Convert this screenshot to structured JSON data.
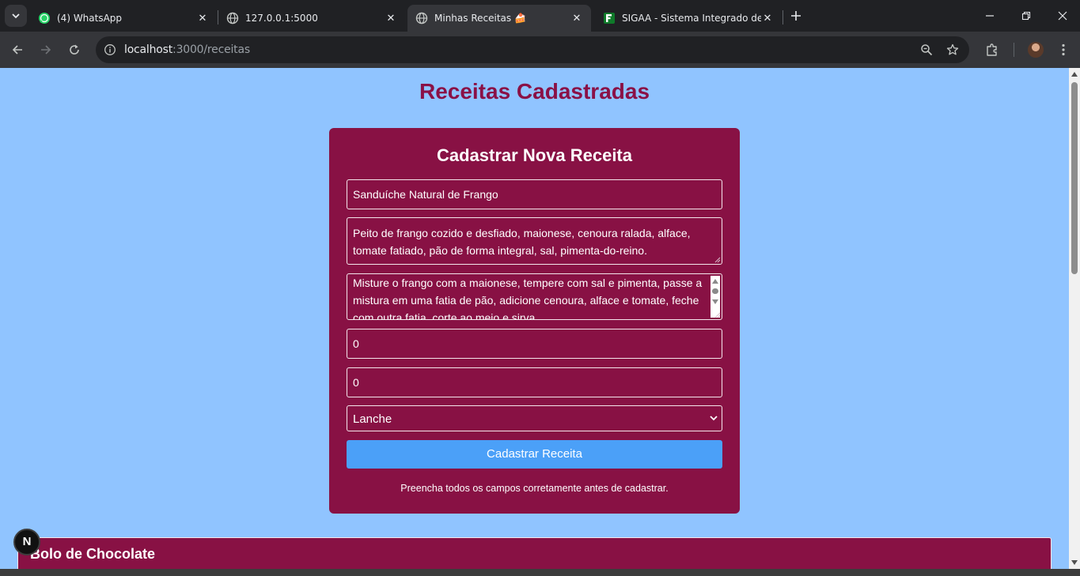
{
  "browser": {
    "tabs": [
      {
        "title": "(4) WhatsApp",
        "icon": "whatsapp-icon"
      },
      {
        "title": "127.0.0.1:5000",
        "icon": "globe-icon"
      },
      {
        "title": "Minhas Receitas 🍰",
        "icon": "globe-icon",
        "active": true
      },
      {
        "title": "SIGAA - Sistema Integrado de G",
        "icon": "sigaa-icon"
      }
    ],
    "url": {
      "host": "localhost",
      "path": ":3000/receitas"
    },
    "colors": {
      "frame": "#202124",
      "toolbar": "#35363a"
    }
  },
  "page": {
    "title": "Receitas Cadastradas",
    "colors": {
      "background": "#90c4ff",
      "card": "#881144",
      "title": "#8a1146",
      "button": "#4ba0f8"
    },
    "form": {
      "heading": "Cadastrar Nova Receita",
      "name_value": "Sanduíche Natural de Frango",
      "ingredients_value": "Peito de frango cozido e desfiado, maionese, cenoura ralada, alface, tomate fatiado, pão de forma integral, sal, pimenta-do-reino.",
      "instructions_value": "Misture o frango com a maionese, tempere com sal e pimenta, passe a mistura em uma fatia de pão, adicione cenoura, alface e tomate, feche com outra fatia, corte ao meio e sirva.",
      "field4_value": "0",
      "field5_value": "0",
      "category_value": "Lanche",
      "submit_label": "Cadastrar Receita",
      "hint": "Preencha todos os campos corretamente antes de cadastrar."
    },
    "recipes": [
      {
        "title": "Bolo de Chocolate"
      }
    ],
    "dev_badge": "N"
  }
}
